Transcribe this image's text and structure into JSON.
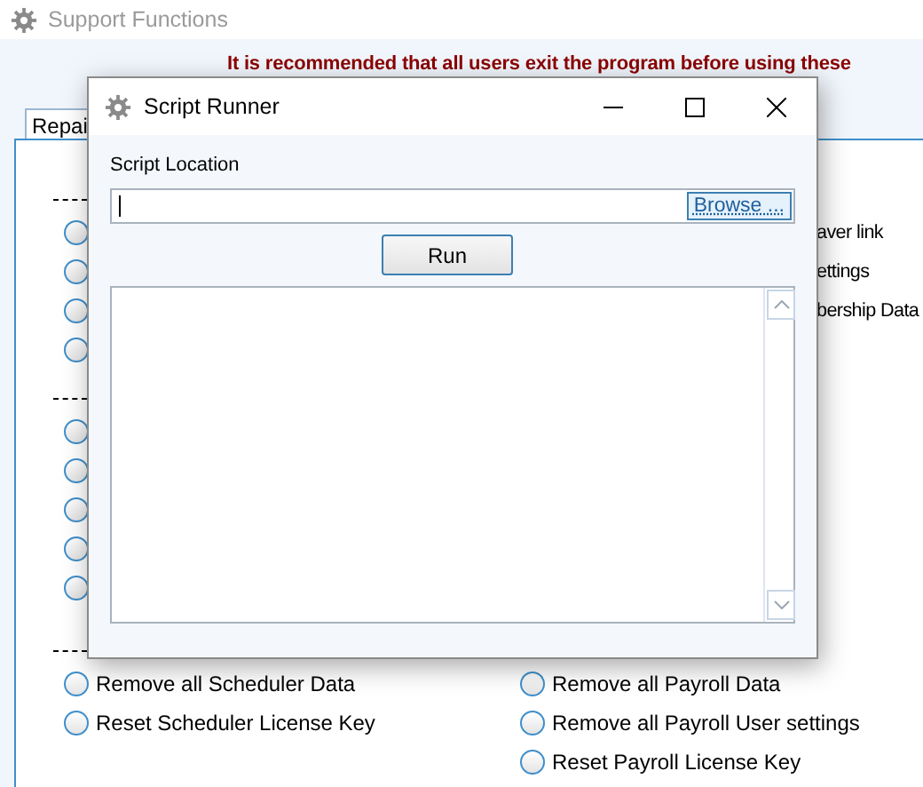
{
  "window": {
    "title": "Support Functions"
  },
  "notice": "It is recommended that all users exit the program before using these",
  "tabs": [
    {
      "label": "Repai",
      "selected": true
    }
  ],
  "sections": [
    {
      "left": [
        {
          "kind": "radio",
          "selected": false
        },
        {
          "kind": "radio",
          "selected": false
        },
        {
          "kind": "radio",
          "selected": false
        },
        {
          "kind": "radio",
          "selected": false
        }
      ],
      "right": [
        {
          "kind": "text",
          "label": "aver link"
        },
        {
          "kind": "text",
          "label": "ettings"
        },
        {
          "kind": "text",
          "label": "bership Data"
        }
      ]
    },
    {
      "left": [
        {
          "kind": "radio",
          "selected": false
        },
        {
          "kind": "radio",
          "selected": false
        },
        {
          "kind": "radio",
          "selected": false
        },
        {
          "kind": "radio",
          "selected": false
        },
        {
          "kind": "radio",
          "selected": false
        }
      ]
    },
    {
      "left": [
        {
          "kind": "radio",
          "label": "Remove all Scheduler Data",
          "selected": false
        },
        {
          "kind": "radio",
          "label": "Reset Scheduler License Key",
          "selected": false
        }
      ],
      "right": [
        {
          "kind": "radio",
          "label": "Remove all Payroll Data",
          "selected": false
        },
        {
          "kind": "radio",
          "label": "Remove all Payroll User settings",
          "selected": false
        },
        {
          "kind": "radio",
          "label": "Reset Payroll License Key",
          "selected": false
        }
      ]
    }
  ],
  "dialog": {
    "title": "Script Runner",
    "field_label": "Script Location",
    "browse_button": "Browse ...",
    "run_button": "Run"
  }
}
